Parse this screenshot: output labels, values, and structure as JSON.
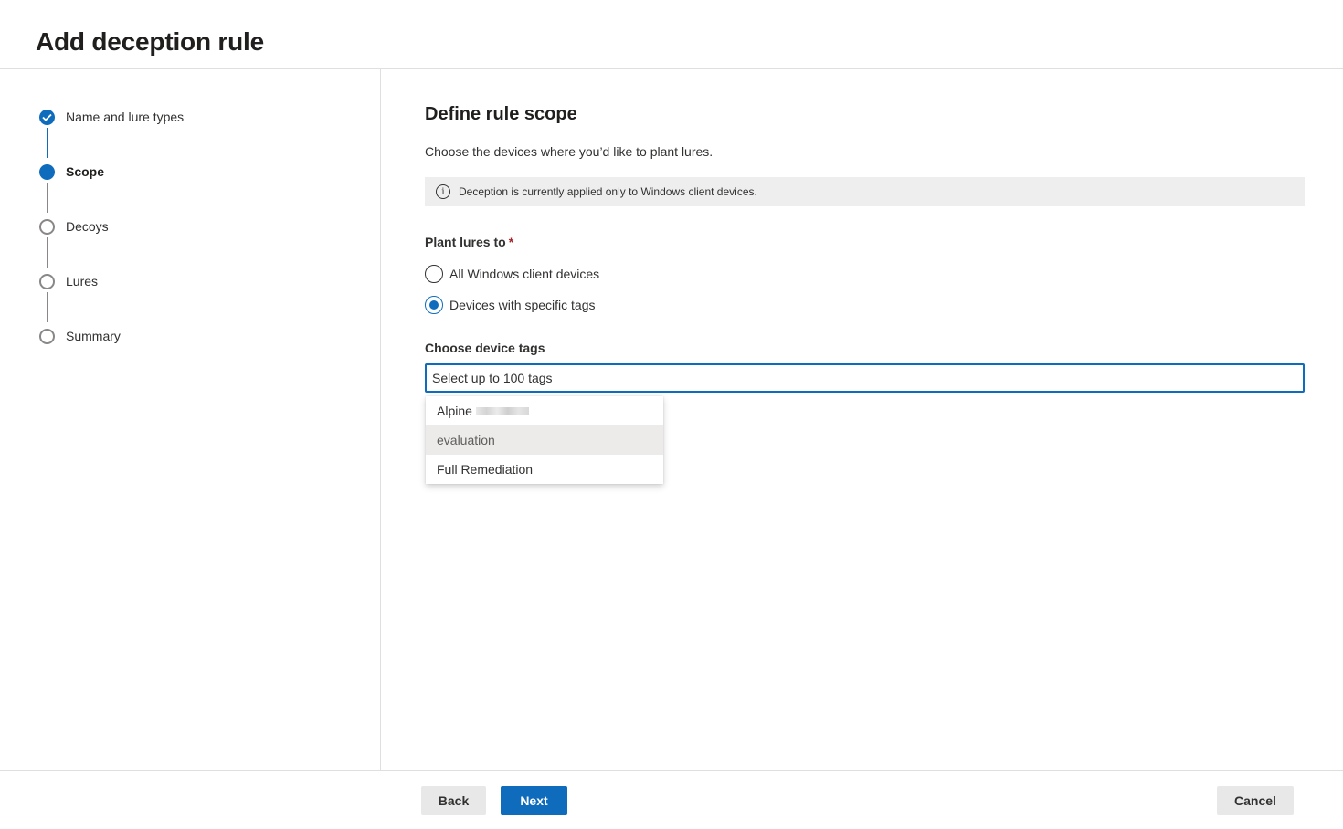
{
  "page": {
    "title": "Add deception rule"
  },
  "steps": [
    {
      "label": "Name and lure types",
      "state": "done"
    },
    {
      "label": "Scope",
      "state": "current"
    },
    {
      "label": "Decoys",
      "state": "todo"
    },
    {
      "label": "Lures",
      "state": "todo"
    },
    {
      "label": "Summary",
      "state": "todo"
    }
  ],
  "main": {
    "title": "Define rule scope",
    "description": "Choose the devices where you’d like to plant lures.",
    "info_text": "Deception is currently applied only to Windows client devices.",
    "plant_label": "Plant lures to",
    "required_mark": "*",
    "radio_options": [
      {
        "label": "All Windows client devices",
        "checked": false
      },
      {
        "label": "Devices with specific tags",
        "checked": true
      }
    ],
    "tags_label": "Choose device tags",
    "tags_placeholder": "Select up to 100 tags",
    "dropdown_options": [
      "Alpine",
      "evaluation",
      "Full Remediation"
    ]
  },
  "footer": {
    "back_label": "Back",
    "next_label": "Next",
    "cancel_label": "Cancel"
  },
  "colors": {
    "accent": "#0f6cbd",
    "required": "#a4262c"
  }
}
